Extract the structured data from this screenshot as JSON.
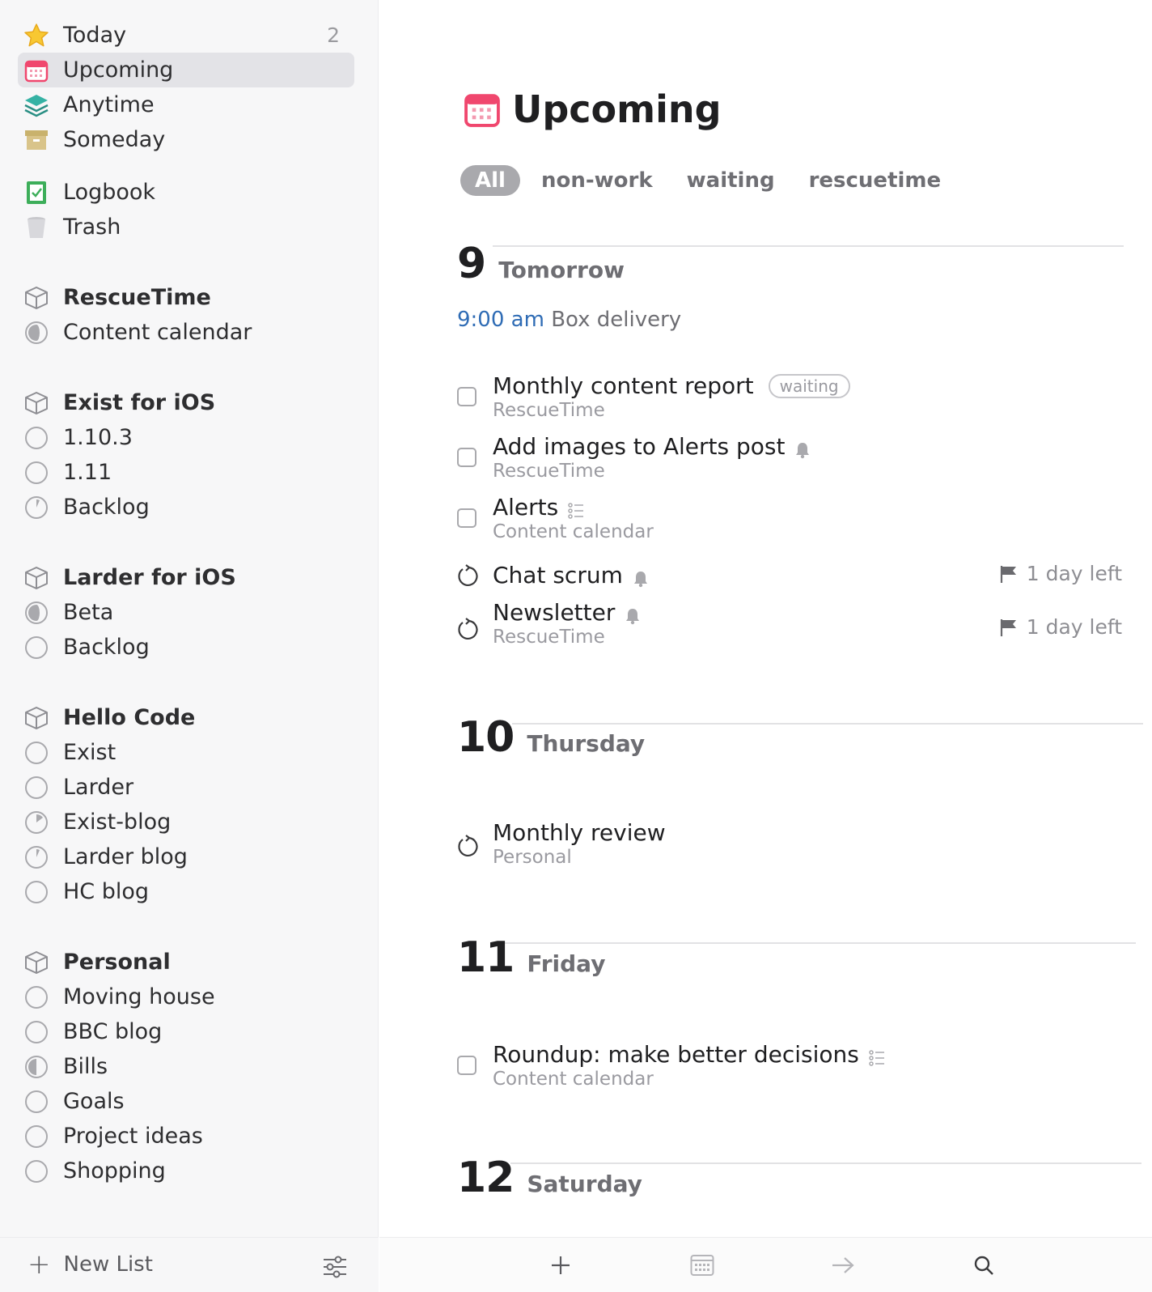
{
  "sidebar": {
    "smart_lists": [
      {
        "label": "Today",
        "icon": "star-icon",
        "count": "2"
      },
      {
        "label": "Upcoming",
        "icon": "calendar-icon",
        "selected": true
      },
      {
        "label": "Anytime",
        "icon": "layers-icon"
      },
      {
        "label": "Someday",
        "icon": "archive-box-icon"
      },
      {
        "label": "Logbook",
        "icon": "logbook-check-icon"
      },
      {
        "label": "Trash",
        "icon": "trash-icon"
      }
    ],
    "areas": [
      {
        "name": "RescueTime",
        "projects": [
          "Content calendar"
        ]
      },
      {
        "name": "Exist for iOS",
        "projects": [
          "1.10.3",
          "1.11",
          "Backlog"
        ]
      },
      {
        "name": "Larder for iOS",
        "projects": [
          "Beta",
          "Backlog"
        ]
      },
      {
        "name": "Hello Code",
        "projects": [
          "Exist",
          "Larder",
          "Exist-blog",
          "Larder blog",
          "HC blog"
        ]
      },
      {
        "name": "Personal",
        "projects": [
          "Moving house",
          "BBC blog",
          "Bills",
          "Goals",
          "Project ideas",
          "Shopping"
        ]
      }
    ],
    "footer": {
      "new_list_label": "New List"
    }
  },
  "main": {
    "title": "Upcoming",
    "tags": [
      "All",
      "non-work",
      "waiting",
      "rescuetime"
    ],
    "days": [
      {
        "num": "9",
        "name": "Tomorrow"
      },
      {
        "num": "10",
        "name": "Thursday"
      },
      {
        "num": "11",
        "name": "Friday"
      },
      {
        "num": "12",
        "name": "Saturday"
      }
    ],
    "event": {
      "time": "9:00 am",
      "name": "Box delivery"
    },
    "todos": [
      {
        "title": "Monthly content report",
        "project": "RescueTime",
        "tag": "waiting"
      },
      {
        "title": "Add images to Alerts post",
        "project": "RescueTime"
      },
      {
        "title": "Alerts",
        "project": "Content calendar"
      },
      {
        "title": "Chat scrum",
        "deadline": "1 day left"
      },
      {
        "title": "Newsletter",
        "project": "RescueTime",
        "deadline": "1 day left"
      },
      {
        "title": "Monthly review",
        "project": "Personal"
      },
      {
        "title": "Roundup: make better decisions",
        "project": "Content calendar"
      }
    ],
    "colors": {
      "accent_calendar": "#f0476e",
      "event_time": "#2f6cb5",
      "anytime": "#2aa198"
    }
  }
}
